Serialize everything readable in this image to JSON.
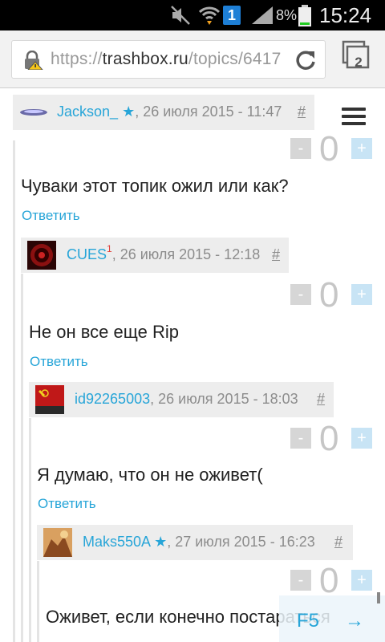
{
  "status_bar": {
    "notification_count": "1",
    "battery_percent": "8%",
    "time": "15:24",
    "icons": [
      "mute-icon",
      "wifi-icon",
      "signal-icon",
      "battery-icon"
    ]
  },
  "browser": {
    "url_scheme": "https://",
    "url_host": "trashbox.ru",
    "url_path": "/topics/6417",
    "tabs_count": "2"
  },
  "comments": [
    {
      "author": "Jackson_",
      "star": "★",
      "date": ", 26 июля 2015 - 11:47",
      "anchor": "#",
      "score": "0",
      "text": "Чуваки этот топик ожил или как?",
      "reply": "Ответить"
    },
    {
      "author": "CUES",
      "superscript": "1",
      "date": ", 26 июля 2015 - 12:18",
      "anchor": "#",
      "score": "0",
      "text": "Не он все еще Rip",
      "reply": "Ответить"
    },
    {
      "author": "id92265003",
      "date": ", 26 июля 2015 - 18:03",
      "anchor": "#",
      "score": "0",
      "text": "Я думаю, что он не оживет(",
      "reply": "Ответить"
    },
    {
      "author": "Maks550A",
      "star": "★",
      "date": ", 27 июля 2015 - 16:23",
      "anchor": "#",
      "score": "0",
      "text": "Оживет, если конечно постараться"
    }
  ],
  "vote": {
    "minus": "-",
    "plus": "+"
  },
  "refresh": {
    "label": "F5",
    "arrow": "→"
  }
}
